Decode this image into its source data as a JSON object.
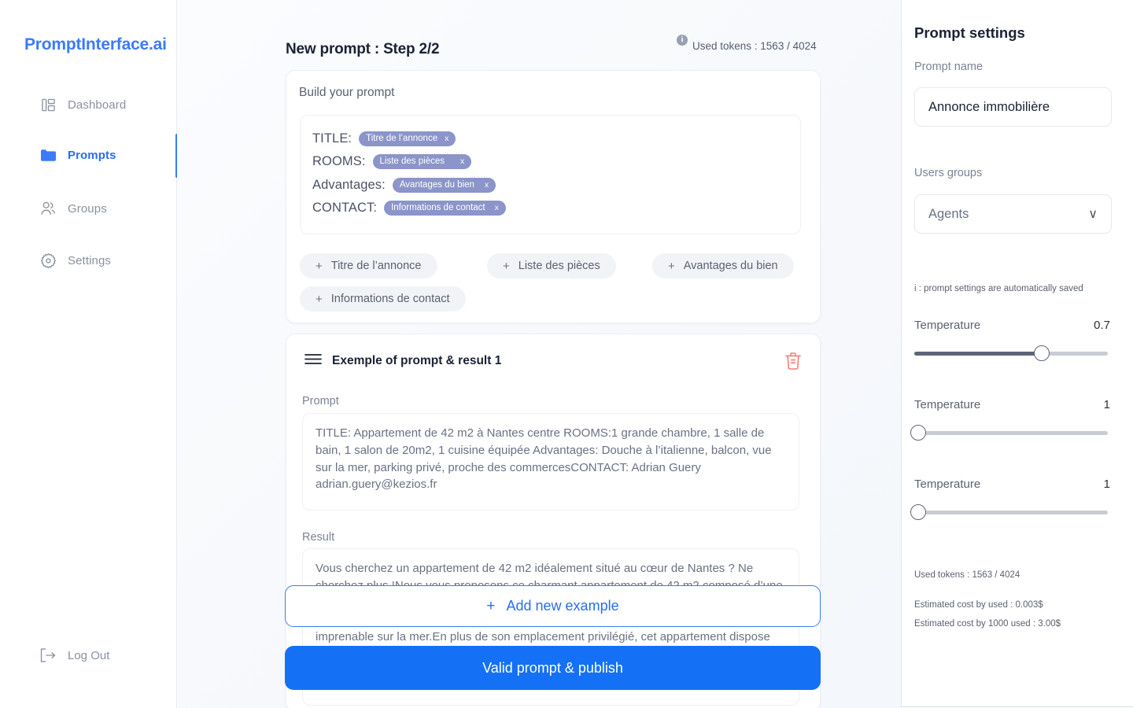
{
  "brand": {
    "name": "PromptInterface.ai"
  },
  "sidebar": {
    "items": [
      {
        "label": "Dashboard",
        "icon": "dashboard-icon",
        "active": false
      },
      {
        "label": "Prompts",
        "icon": "folder-icon",
        "active": true
      },
      {
        "label": "Groups",
        "icon": "users-icon",
        "active": false
      },
      {
        "label": "Settings",
        "icon": "gear-icon",
        "active": false
      }
    ],
    "logout": {
      "label": "Log Out",
      "icon": "logout-icon"
    }
  },
  "header": {
    "title": "New prompt : Step 2/2",
    "info_icon": "info-icon",
    "tokens": "Used tokens : 1563 / 4024"
  },
  "build": {
    "title": "Build your prompt",
    "rows": [
      {
        "key": "TITLE:",
        "chip": "Titre de l’annonce",
        "remove": "x"
      },
      {
        "key": "ROOMS:",
        "chip": "Liste des pièces",
        "remove": "x"
      },
      {
        "key": "Advantages:",
        "chip": "Avantages du bien",
        "remove": "x"
      },
      {
        "key": "CONTACT:",
        "chip": "Informations de contact",
        "remove": "x"
      }
    ],
    "add_buttons": [
      {
        "plus": "+",
        "label": "Titre de l’annonce"
      },
      {
        "plus": "+",
        "label": "Liste des pièces"
      },
      {
        "plus": "+",
        "label": "Avantages du bien"
      },
      {
        "plus": "+",
        "label": "Informations de contact"
      }
    ]
  },
  "example": {
    "menu_icon": "hamburger-icon",
    "title": "Exemple of prompt & result 1",
    "delete_icon": "trash-icon",
    "prompt_label": "Prompt",
    "prompt_value": "TITLE: Appartement de 42 m2 à Nantes centre ROOMS:1 grande chambre, 1 salle de bain, 1 salon de 20m2, 1 cuisine équipée Advantages: Douche à l’italienne, balcon, vue sur la mer, parking privé, proche des commercesCONTACT: Adrian Guery adrian.guery@kezios.fr",
    "result_label": "Result",
    "result_value": "Vous cherchez un appartement de 42 m2 idéalement situé au cœur de Nantes ? Ne cherchez plus !Nous vous proposons ce charmant appartement de 42 m2 composé d’une grande chambre, d’une salle de bain, d’un salon de 20 m2 et d’une cuisine équipée. Vous bénéficierez également d’une douche à l’italienne et d’un balcon offrant une vue imprenable sur la mer.En plus de son emplacement privilégié, cet appartement dispose d’un parking."
  },
  "actions": {
    "add_example_plus": "+",
    "add_example_label": "Add new example",
    "valid_label": "Valid prompt & publish"
  },
  "settings": {
    "title": "Prompt settings",
    "prompt_name_label": "Prompt name",
    "prompt_name_value": "Annonce immobilière",
    "users_groups_label": "Users groups",
    "users_groups_value": "Agents",
    "users_groups_chevron": "∨",
    "note": "i : prompt settings are automatically saved",
    "sliders": [
      {
        "name": "Temperature",
        "value": "0.7",
        "percent": 66
      },
      {
        "name": "Temperature",
        "value": "1",
        "percent": 0
      },
      {
        "name": "Temperature",
        "value": "1",
        "percent": 0
      }
    ],
    "stats": [
      "Used tokens : 1563 / 4024",
      "Estimated cost by used : 0.003$",
      "Estimated cost by 1000 used : 3.00$"
    ]
  },
  "colors": {
    "brand_blue": "#3b7bf8",
    "action_blue": "#1471f5",
    "chip_purple": "#8b95c9",
    "danger_red": "#f97c7c"
  }
}
